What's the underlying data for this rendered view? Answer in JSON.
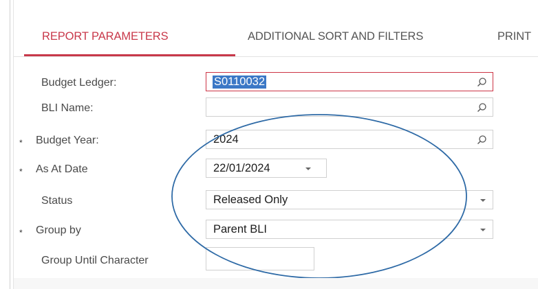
{
  "tabs": [
    {
      "label": "REPORT PARAMETERS",
      "active": true
    },
    {
      "label": "ADDITIONAL SORT AND FILTERS",
      "active": false
    },
    {
      "label": "PRINT",
      "active": false
    }
  ],
  "form": {
    "budget_ledger": {
      "label": "Budget Ledger:",
      "value": "S0110032",
      "icon": "search-icon",
      "focused": true,
      "required": false
    },
    "bli_name": {
      "label": "BLI Name:",
      "value": "",
      "icon": "search-icon",
      "required": false
    },
    "budget_year": {
      "label": "Budget Year:",
      "value": "2024",
      "icon": "search-icon",
      "required": true
    },
    "as_at_date": {
      "label": "As At Date",
      "value": "22/01/2024",
      "icon": "chevron-down-icon",
      "required": true
    },
    "status": {
      "label": "Status",
      "value": "Released Only",
      "icon": "chevron-down-icon",
      "required": false
    },
    "group_by": {
      "label": "Group by",
      "value": "Parent BLI",
      "icon": "chevron-down-icon",
      "required": true
    },
    "group_until_character": {
      "label": "Group Until Character",
      "value": "",
      "required": false
    }
  },
  "required_marker": "*",
  "colors": {
    "accent": "#c8384a",
    "selection": "#3b78c6",
    "annotation": "#2e6aa6"
  }
}
